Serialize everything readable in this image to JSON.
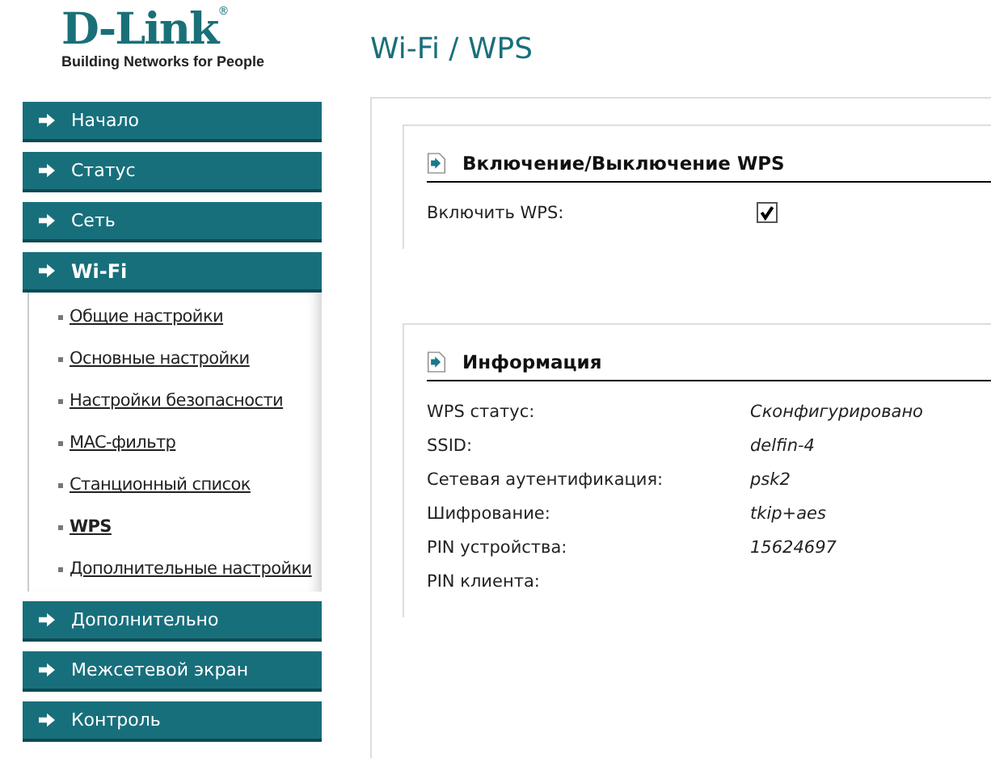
{
  "logo": {
    "name": "D-Link",
    "mark": "®",
    "tagline": "Building Networks for People"
  },
  "menu": [
    {
      "label": "Начало",
      "selected": false
    },
    {
      "label": "Статус",
      "selected": false
    },
    {
      "label": "Сеть",
      "selected": false
    },
    {
      "label": "Wi-Fi",
      "selected": true,
      "expanded": true,
      "children": [
        {
          "label": "Общие настройки",
          "selected": false
        },
        {
          "label": "Основные настройки",
          "selected": false
        },
        {
          "label": "Настройки безопасности",
          "selected": false
        },
        {
          "label": "MAC-фильтр",
          "selected": false
        },
        {
          "label": "Станционный список",
          "selected": false
        },
        {
          "label": "WPS",
          "selected": true
        },
        {
          "label": "Дополнительные настройки",
          "selected": false
        }
      ]
    },
    {
      "label": "Дополнительно",
      "selected": false
    },
    {
      "label": "Межсетевой экран",
      "selected": false
    },
    {
      "label": "Контроль",
      "selected": false
    }
  ],
  "page_title": "Wi-Fi / WPS",
  "sections": [
    {
      "title": "Включение/Выключение WPS",
      "rows": [
        {
          "kind": "checkbox",
          "label": "Включить WPS:",
          "checked": true
        }
      ]
    },
    {
      "title": "Информация",
      "rows": [
        {
          "kind": "info",
          "label": "WPS статус:",
          "value": "Сконфигурировано"
        },
        {
          "kind": "info",
          "label": "SSID:",
          "value": "delfin-4"
        },
        {
          "kind": "info",
          "label": "Сетевая аутентификация:",
          "value": "psk2"
        },
        {
          "kind": "info",
          "label": "Шифрование:",
          "value": "tkip+aes"
        },
        {
          "kind": "info",
          "label": "PIN устройства:",
          "value": "15624697"
        },
        {
          "kind": "info",
          "label": "PIN клиента:"
        }
      ]
    }
  ]
}
